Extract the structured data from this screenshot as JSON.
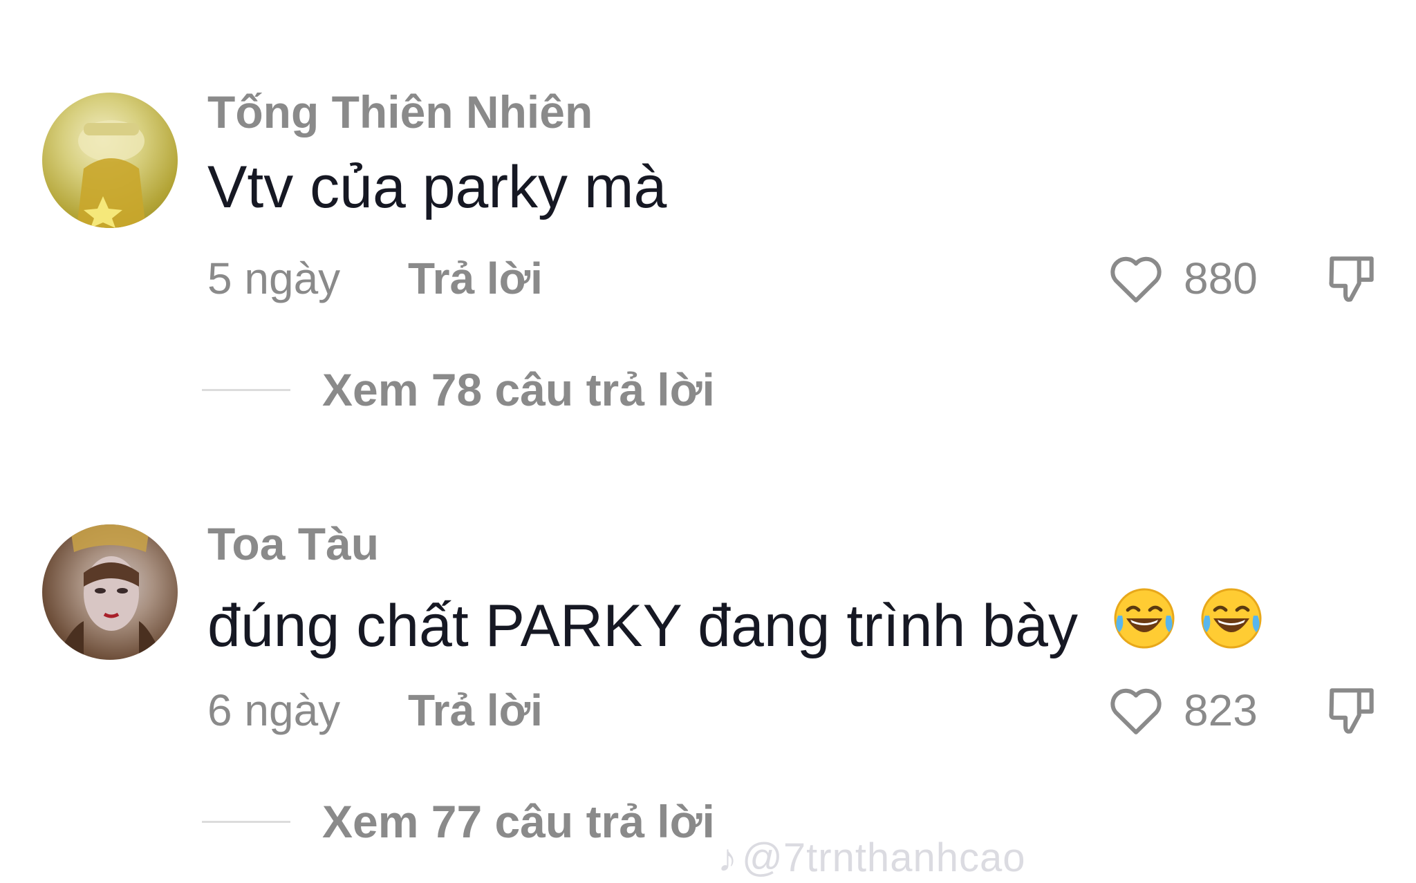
{
  "comments": [
    {
      "username": "Tống Thiên Nhiên",
      "text": "Vtv của parky mà",
      "date": "5 ngày",
      "reply_label": "Trả lời",
      "likes": "880",
      "view_replies": "Xem 78 câu trả lời",
      "avatar_icon": "avatar-yellow-frog",
      "emojis": []
    },
    {
      "username": "Toa Tàu",
      "text": "đúng chất PARKY đang trình bày",
      "date": "6 ngày",
      "reply_label": "Trả lời",
      "likes": "823",
      "view_replies": "Xem 77 câu trả lời",
      "avatar_icon": "avatar-woman-portrait",
      "emojis": [
        "tears-of-joy-emoji",
        "tears-of-joy-emoji"
      ]
    }
  ],
  "watermark": {
    "icon": "tiktok-logo-icon",
    "handle": "@7trnthanhcao"
  },
  "colors": {
    "background": "#ffffff",
    "primary_text": "#161823",
    "secondary_text": "#8a8a8a"
  }
}
